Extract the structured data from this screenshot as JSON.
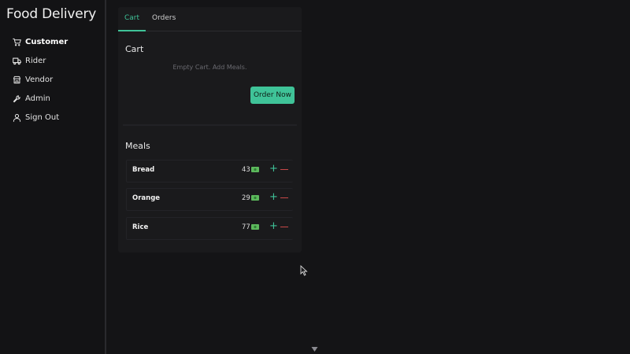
{
  "app": {
    "title": "Food Delivery"
  },
  "sidebar": {
    "items": [
      {
        "label": "Customer",
        "icon": "cart-icon",
        "active": true
      },
      {
        "label": "Rider",
        "icon": "truck-icon",
        "active": false
      },
      {
        "label": "Vendor",
        "icon": "store-icon",
        "active": false
      },
      {
        "label": "Admin",
        "icon": "wrench-icon",
        "active": false
      },
      {
        "label": "Sign Out",
        "icon": "user-icon",
        "active": false
      }
    ]
  },
  "tabs": [
    {
      "label": "Cart",
      "active": true
    },
    {
      "label": "Orders",
      "active": false
    }
  ],
  "cart": {
    "title": "Cart",
    "empty_message": "Empty Cart. Add Meals.",
    "order_button": "Order Now"
  },
  "meals": {
    "title": "Meals",
    "items": [
      {
        "name": "Bread",
        "price": "43",
        "price_icon": "money-icon"
      },
      {
        "name": "Orange",
        "price": "29",
        "price_icon": "money-icon"
      },
      {
        "name": "Rice",
        "price": "77",
        "price_icon": "money-icon"
      }
    ],
    "add_symbol": "+"
  },
  "colors": {
    "accent": "#3fc398",
    "remove": "#c74848",
    "background": "#141416",
    "panel": "#1a1a1c"
  }
}
